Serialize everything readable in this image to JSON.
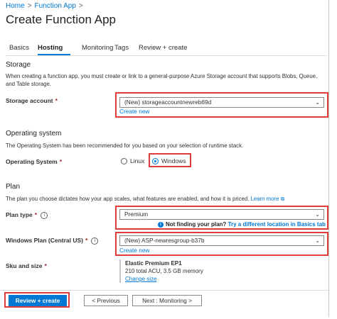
{
  "breadcrumb": {
    "home": "Home",
    "sep1": ">",
    "function_app": "Function App",
    "sep2": ">"
  },
  "page_title": "Create Function App",
  "tabs": {
    "basics": "Basics",
    "hosting": "Hosting",
    "monitoring": "Monitoring",
    "tags": "Tags",
    "review": "Review + create"
  },
  "storage": {
    "heading": "Storage",
    "description": "When creating a function app, you must create or link to a general-purpose Azure Storage account that supports Blobs, Queue, and Table storage.",
    "label": "Storage account",
    "required": "*",
    "value": "(New) storageaccountnewreb69d",
    "create_new": "Create new"
  },
  "os": {
    "heading": "Operating system",
    "description": "The Operating System has been recommended for you based on your selection of runtime stack.",
    "label": "Operating System",
    "required": "*",
    "linux": "Linux",
    "windows": "Windows",
    "selected": "Windows"
  },
  "plan": {
    "heading": "Plan",
    "description": "The plan you choose dictates how your app scales, what features are enabled, and how it is priced.",
    "learn_more": "Learn more",
    "plan_type_label": "Plan type",
    "plan_type_required": "*",
    "plan_type_value": "Premium",
    "not_finding": "Not finding your plan?",
    "try_location": "Try a different location in Basics tab",
    "windows_plan_label": "Windows Plan (Central US)",
    "windows_plan_required": "*",
    "windows_plan_value": "(New) ASP-newresgroup-b37b",
    "create_new": "Create new",
    "sku_label": "Sku and size",
    "sku_required": "*",
    "sku_name": "Elastic Premium EP1",
    "sku_detail": "210 total ACU, 3.5 GB memory",
    "sku_change": "Change size"
  },
  "footer": {
    "review_create": "Review + create",
    "previous": "< Previous",
    "next": "Next : Monitoring >"
  },
  "colors": {
    "accent": "#0078d4",
    "highlight": "#e03c3c",
    "required": "#a4262c"
  }
}
